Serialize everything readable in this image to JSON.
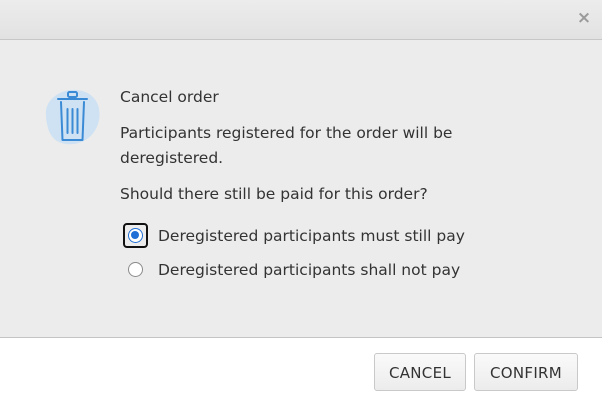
{
  "dialog": {
    "close_glyph": "×",
    "heading": "Cancel order",
    "message": "Participants registered for the order will be deregistered.",
    "question": "Should there still be paid for this order?",
    "options": [
      {
        "label": "Deregistered participants must still pay",
        "selected": true
      },
      {
        "label": "Deregistered participants shall not pay",
        "selected": false
      }
    ],
    "icon": "trash-icon"
  },
  "footer": {
    "cancel_label": "CANCEL",
    "confirm_label": "CONFIRM"
  },
  "colors": {
    "accent": "#1f6fd6",
    "icon_bg": "#cfe2f3",
    "icon_stroke": "#3a8ad6"
  }
}
